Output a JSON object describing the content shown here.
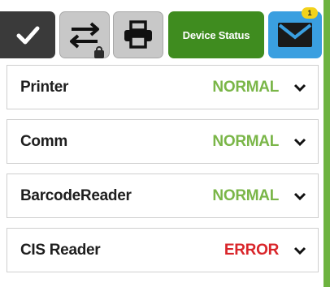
{
  "toolbar": {
    "device_status_label": "Device Status",
    "mail_badge_count": "1",
    "icons": [
      "checkmark-icon",
      "transfer-arrows-icon",
      "lock-icon",
      "printer-icon",
      "mail-icon"
    ],
    "colors": {
      "green": "#3f8c1f",
      "mail_blue": "#3a9fe0",
      "badge_yellow": "#f3d21b"
    }
  },
  "devices": [
    {
      "label": "Printer",
      "status": "NORMAL",
      "status_color": "#7ab648"
    },
    {
      "label": "Comm",
      "status": "NORMAL",
      "status_color": "#7ab648"
    },
    {
      "label": "BarcodeReader",
      "status": "NORMAL",
      "status_color": "#7ab648"
    },
    {
      "label": "CIS Reader",
      "status": "ERROR",
      "status_color": "#d9252a"
    }
  ]
}
